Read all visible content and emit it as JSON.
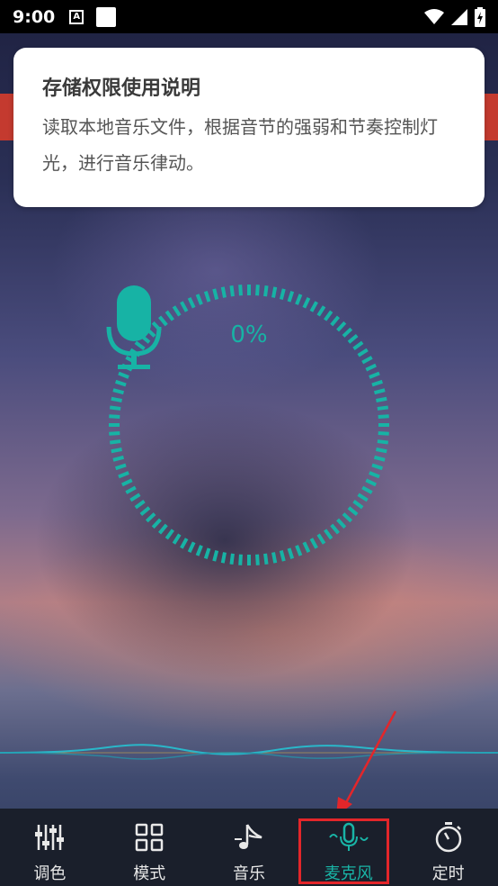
{
  "status_bar": {
    "time": "9:00",
    "a_icon_text": "A",
    "icons": [
      "notification-a-icon",
      "square-icon",
      "wifi-icon",
      "signal-icon",
      "battery-charging-icon"
    ]
  },
  "permission_card": {
    "title": "存储权限使用说明",
    "body": "读取本地音乐文件，根据音节的强弱和节奏控制灯光，进行音乐律动。"
  },
  "mic_panel": {
    "percent": "0%",
    "level": 0,
    "accent_color": "#17b3a5",
    "icon": "microphone-icon"
  },
  "bottom_nav": {
    "items": [
      {
        "label": "调色",
        "icon": "sliders-icon",
        "active": false
      },
      {
        "label": "模式",
        "icon": "grid-icon",
        "active": false
      },
      {
        "label": "音乐",
        "icon": "music-note-icon",
        "active": false
      },
      {
        "label": "麦克风",
        "icon": "microphone-wave-icon",
        "active": true
      },
      {
        "label": "定时",
        "icon": "stopwatch-icon",
        "active": false
      }
    ],
    "active_color": "#19b4a6"
  },
  "annotation": {
    "highlight_color": "#e3262a"
  }
}
